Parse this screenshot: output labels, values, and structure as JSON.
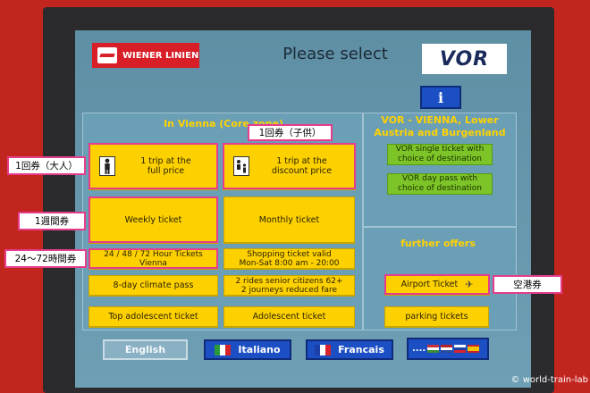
{
  "header": {
    "brand_left": "WIENER LINIEN",
    "title": "Please select",
    "brand_right": "VOR",
    "info_label": "i"
  },
  "vienna": {
    "title": "In Vienna (Core zone)",
    "full_price": "1 trip at the\nfull price",
    "discount_price": "1 trip at the\ndiscount price",
    "weekly": "Weekly ticket",
    "monthly": "Monthly ticket",
    "hour_tickets": "24 / 48 / 72 Hour Tickets\nVienna",
    "shopping": "Shopping ticket valid\nMon-Sat 8:00 am - 20:00",
    "climate": "8-day climate pass",
    "senior": "2 rides senior citizens 62+\n2 journeys reduced fare",
    "adolescent_top": "Top adolescent ticket",
    "adolescent": "Adolescent ticket"
  },
  "vor": {
    "title": "VOR - VIENNA, Lower\nAustria and Burgenland",
    "single": "VOR single ticket with\nchoice of destination",
    "day_pass": "VOR day pass with\nchoice of destination"
  },
  "offers": {
    "title": "further offers",
    "airport": "Airport Ticket",
    "parking": "parking tickets"
  },
  "languages": {
    "english": "English",
    "italiano": "Italiano",
    "francais": "Francais",
    "more": "...."
  },
  "annotations": {
    "single_adult": "1回券（大人）",
    "single_child": "1回券（子供）",
    "weekly": "1週間券",
    "hours": "24〜72時間券",
    "airport": "空港券"
  },
  "credit": "© world-train-lab",
  "colors": {
    "frame_red": "#c2241e",
    "screen_blue": "#6b9fb6",
    "ticket_yellow": "#fdd000",
    "vor_green": "#7cc427",
    "lang_blue": "#1d4fc4",
    "annotation_pink": "#e53d8c",
    "title_yellow": "#ffd200"
  }
}
